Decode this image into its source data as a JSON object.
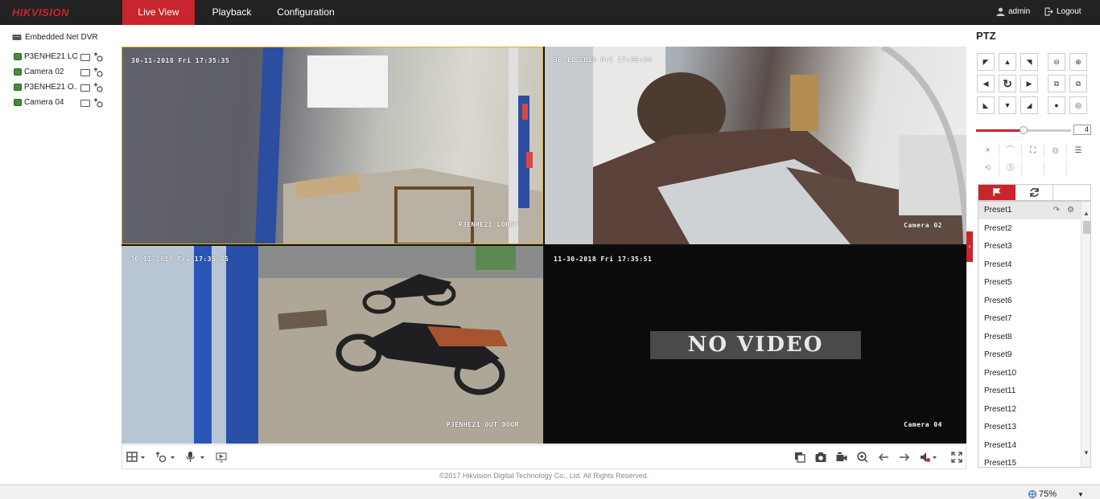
{
  "brand": {
    "logo": "HIKVISION",
    "accent": "#c8252c"
  },
  "nav": {
    "tabs": [
      {
        "label": "Live View",
        "active": true
      },
      {
        "label": "Playback"
      },
      {
        "label": "Configuration"
      }
    ]
  },
  "user": {
    "name": "admin",
    "logout_label": "Logout"
  },
  "device_tree": {
    "root": "Embedded Net DVR",
    "cameras": [
      {
        "label": "P3ENHE21 LO..."
      },
      {
        "label": "Camera 02"
      },
      {
        "label": "P3ENHE21 O..."
      },
      {
        "label": "Camera 04"
      }
    ]
  },
  "video_tiles": [
    {
      "timestamp": "30-11-2018 Fri 17:35:35",
      "name": "P3ENHE21 LOBBY",
      "selected": true
    },
    {
      "timestamp": "30-11-2018 Fri 17:35:34",
      "name": "Camera 02"
    },
    {
      "timestamp": "30-11-2018 Fri 17:35:35",
      "name": "P3ENHE21 OUT DOOR"
    },
    {
      "timestamp": "11-30-2018 Fri 17:35:51",
      "name": "Camera 04",
      "message": "NO VIDEO"
    }
  ],
  "toolbar": {
    "left_icons": [
      "window-layout-icon",
      "stream-icon",
      "microphone-icon",
      "start-all-icon"
    ],
    "right_icons": [
      "stop-all-icon",
      "capture-icon",
      "record-icon",
      "digital-zoom-icon",
      "prev-page-icon",
      "next-page-icon",
      "volume-icon",
      "fullscreen-icon"
    ]
  },
  "copyright": "©2017 Hikvision Digital Technology Co., Ltd. All Rights Reserved.",
  "ptz": {
    "title": "PTZ",
    "speed": "4",
    "speed_fraction": 0.5,
    "tabs": [
      "preset-flag-icon",
      "patrol-icon"
    ],
    "presets": [
      "Preset1",
      "Preset2",
      "Preset3",
      "Preset4",
      "Preset5",
      "Preset6",
      "Preset7",
      "Preset8",
      "Preset9",
      "Preset10",
      "Preset11",
      "Preset12",
      "Preset13",
      "Preset14",
      "Preset15"
    ]
  },
  "status": {
    "zoom": "75%"
  }
}
